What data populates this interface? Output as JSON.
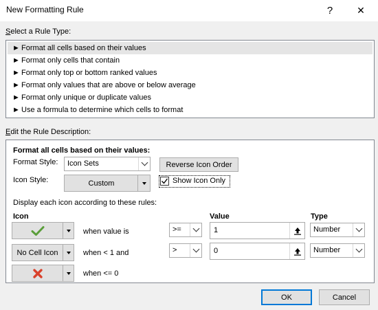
{
  "window": {
    "title": "New Formatting Rule",
    "help_glyph": "?",
    "close_glyph": "✕"
  },
  "rule_type": {
    "label": "Select a Rule Type:",
    "accel": "S",
    "label_rest": "elect a Rule Type:",
    "arrow": "►",
    "items": [
      "Format all cells based on their values",
      "Format only cells that contain",
      "Format only top or bottom ranked values",
      "Format only values that are above or below average",
      "Format only unique or duplicate values",
      "Use a formula to determine which cells to format"
    ],
    "selected_index": 0
  },
  "description": {
    "label": "Edit the Rule Description:",
    "accel": "E",
    "label_rest": "dit the Rule Description:",
    "heading": "Format all cells based on their values:",
    "format_style_label": "Format Style:",
    "format_style_value": "Icon Sets",
    "icon_style_label": "Icon Style:",
    "icon_style_value": "Custom",
    "reverse_button": "Reverse Icon Order",
    "show_icon_only": "Show Icon Only",
    "show_icon_only_checked": true,
    "rules_intro": "Display each icon according to these rules:",
    "col_icon": "Icon",
    "col_value": "Value",
    "col_type": "Type",
    "rows": [
      {
        "icon": "green-checkmark",
        "icon_label": "",
        "condition": "when value is",
        "operator": ">=",
        "value": "1",
        "type": "Number"
      },
      {
        "icon": "none",
        "icon_label": "No Cell Icon",
        "condition": "when < 1 and",
        "operator": ">",
        "value": "0",
        "type": "Number"
      },
      {
        "icon": "red-x",
        "icon_label": "",
        "condition": "when <= 0"
      }
    ],
    "colors": {
      "check": "#5a9e3a",
      "x": "#d9412b",
      "accent": "#0078d7"
    }
  },
  "buttons": {
    "ok": "OK",
    "cancel": "Cancel"
  }
}
